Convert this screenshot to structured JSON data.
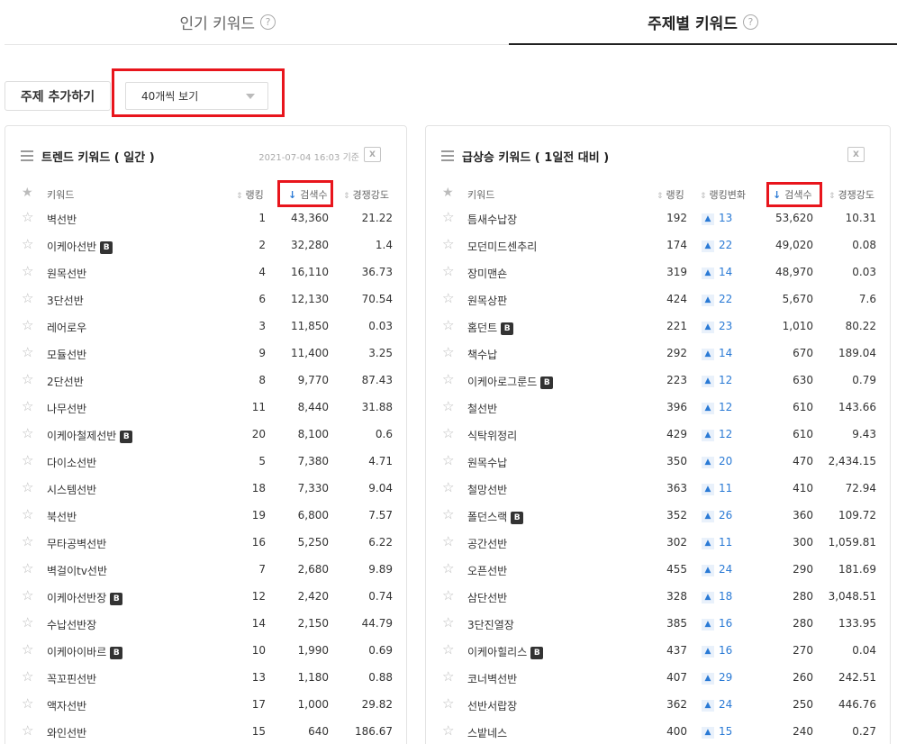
{
  "tabs": [
    {
      "label": "인기 키워드",
      "help": "?"
    },
    {
      "label": "주제별 키워드",
      "help": "?"
    }
  ],
  "controls": {
    "add_label": "주제 추가하기",
    "view_select": "40개씩 보기"
  },
  "trend": {
    "title": "트렌드 키워드 ( 일간 )",
    "date": "2021-07-04 16:03 기준",
    "xls": "X",
    "headers": {
      "keyword": "키워드",
      "rank": "랭킹",
      "search": "검색수",
      "compete": "경쟁강도"
    },
    "rows": [
      {
        "kw": "벽선반",
        "b": "",
        "rank": "1",
        "search": "43,360",
        "comp": "21.22"
      },
      {
        "kw": "이케아선반",
        "b": "B",
        "rank": "2",
        "search": "32,280",
        "comp": "1.4"
      },
      {
        "kw": "원목선반",
        "b": "",
        "rank": "4",
        "search": "16,110",
        "comp": "36.73"
      },
      {
        "kw": "3단선반",
        "b": "",
        "rank": "6",
        "search": "12,130",
        "comp": "70.54"
      },
      {
        "kw": "레어로우",
        "b": "",
        "rank": "3",
        "search": "11,850",
        "comp": "0.03"
      },
      {
        "kw": "모듈선반",
        "b": "",
        "rank": "9",
        "search": "11,400",
        "comp": "3.25"
      },
      {
        "kw": "2단선반",
        "b": "",
        "rank": "8",
        "search": "9,770",
        "comp": "87.43"
      },
      {
        "kw": "나무선반",
        "b": "",
        "rank": "11",
        "search": "8,440",
        "comp": "31.88"
      },
      {
        "kw": "이케아철제선반",
        "b": "B",
        "rank": "20",
        "search": "8,100",
        "comp": "0.6"
      },
      {
        "kw": "다이소선반",
        "b": "",
        "rank": "5",
        "search": "7,380",
        "comp": "4.71"
      },
      {
        "kw": "시스템선반",
        "b": "",
        "rank": "18",
        "search": "7,330",
        "comp": "9.04"
      },
      {
        "kw": "북선반",
        "b": "",
        "rank": "19",
        "search": "6,800",
        "comp": "7.57"
      },
      {
        "kw": "무타공벽선반",
        "b": "",
        "rank": "16",
        "search": "5,250",
        "comp": "6.22"
      },
      {
        "kw": "벽걸이tv선반",
        "b": "",
        "rank": "7",
        "search": "2,680",
        "comp": "9.89"
      },
      {
        "kw": "이케아선반장",
        "b": "B",
        "rank": "12",
        "search": "2,420",
        "comp": "0.74"
      },
      {
        "kw": "수납선반장",
        "b": "",
        "rank": "14",
        "search": "2,150",
        "comp": "44.79"
      },
      {
        "kw": "이케아이바르",
        "b": "B",
        "rank": "10",
        "search": "1,990",
        "comp": "0.69"
      },
      {
        "kw": "꼭꼬핀선반",
        "b": "",
        "rank": "13",
        "search": "1,180",
        "comp": "0.88"
      },
      {
        "kw": "액자선반",
        "b": "",
        "rank": "17",
        "search": "1,000",
        "comp": "29.82"
      },
      {
        "kw": "와인선반",
        "b": "",
        "rank": "15",
        "search": "640",
        "comp": "186.67"
      }
    ]
  },
  "rising": {
    "title": "급상승 키워드 ( 1일전 대비 )",
    "xls": "X",
    "headers": {
      "keyword": "키워드",
      "rank": "랭킹",
      "change": "랭킹변화",
      "search": "검색수",
      "compete": "경쟁강도"
    },
    "rows": [
      {
        "kw": "틈새수납장",
        "b": "",
        "rank": "192",
        "chg": "13",
        "search": "53,620",
        "comp": "10.31"
      },
      {
        "kw": "모던미드센추리",
        "b": "",
        "rank": "174",
        "chg": "22",
        "search": "49,020",
        "comp": "0.08"
      },
      {
        "kw": "장미맨숀",
        "b": "",
        "rank": "319",
        "chg": "14",
        "search": "48,970",
        "comp": "0.03"
      },
      {
        "kw": "원목상판",
        "b": "",
        "rank": "424",
        "chg": "22",
        "search": "5,670",
        "comp": "7.6"
      },
      {
        "kw": "홈던트",
        "b": "B",
        "rank": "221",
        "chg": "23",
        "search": "1,010",
        "comp": "80.22"
      },
      {
        "kw": "책수납",
        "b": "",
        "rank": "292",
        "chg": "14",
        "search": "670",
        "comp": "189.04"
      },
      {
        "kw": "이케아로그룬드",
        "b": "B",
        "rank": "223",
        "chg": "12",
        "search": "630",
        "comp": "0.79"
      },
      {
        "kw": "철선반",
        "b": "",
        "rank": "396",
        "chg": "12",
        "search": "610",
        "comp": "143.66"
      },
      {
        "kw": "식탁위정리",
        "b": "",
        "rank": "429",
        "chg": "12",
        "search": "610",
        "comp": "9.43"
      },
      {
        "kw": "원목수납",
        "b": "",
        "rank": "350",
        "chg": "20",
        "search": "470",
        "comp": "2,434.15"
      },
      {
        "kw": "철망선반",
        "b": "",
        "rank": "363",
        "chg": "11",
        "search": "410",
        "comp": "72.94"
      },
      {
        "kw": "폴던스랙",
        "b": "B",
        "rank": "352",
        "chg": "26",
        "search": "360",
        "comp": "109.72"
      },
      {
        "kw": "공간선반",
        "b": "",
        "rank": "302",
        "chg": "11",
        "search": "300",
        "comp": "1,059.81"
      },
      {
        "kw": "오픈선반",
        "b": "",
        "rank": "455",
        "chg": "24",
        "search": "290",
        "comp": "181.69"
      },
      {
        "kw": "삼단선반",
        "b": "",
        "rank": "328",
        "chg": "18",
        "search": "280",
        "comp": "3,048.51"
      },
      {
        "kw": "3단진열장",
        "b": "",
        "rank": "385",
        "chg": "16",
        "search": "280",
        "comp": "133.95"
      },
      {
        "kw": "이케아힐리스",
        "b": "B",
        "rank": "437",
        "chg": "16",
        "search": "270",
        "comp": "0.04"
      },
      {
        "kw": "코너벽선반",
        "b": "",
        "rank": "407",
        "chg": "29",
        "search": "260",
        "comp": "242.51"
      },
      {
        "kw": "선반서랍장",
        "b": "",
        "rank": "362",
        "chg": "24",
        "search": "250",
        "comp": "446.76"
      },
      {
        "kw": "스밭네스",
        "b": "",
        "rank": "400",
        "chg": "15",
        "search": "240",
        "comp": "0.27"
      }
    ]
  },
  "colors": {
    "highlight": "#e8151c",
    "accent": "#2a7ad5"
  },
  "icons": [
    "question-icon",
    "caret-down-icon",
    "menu-icon",
    "excel-icon",
    "star-icon",
    "sort-icon",
    "sort-down-icon",
    "up-arrow-icon"
  ]
}
